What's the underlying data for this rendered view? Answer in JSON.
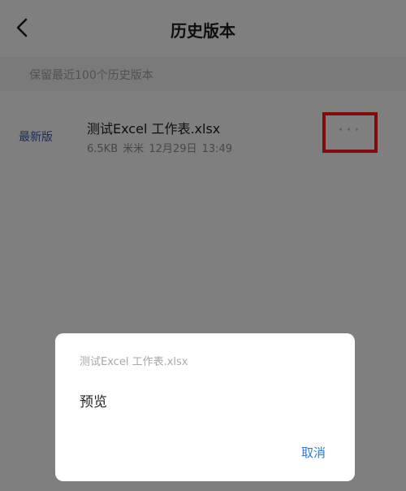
{
  "header": {
    "title": "历史版本"
  },
  "info": {
    "hint": "保留最近100个历史版本"
  },
  "version_item": {
    "badge": "最新版",
    "filename": "测试Excel 工作表.xlsx",
    "meta": "6.5KB  米米  12月29日 13:49",
    "more_glyph": "···"
  },
  "dialog": {
    "title": "测试Excel 工作表.xlsx",
    "preview_label": "预览",
    "cancel_label": "取消"
  },
  "colors": {
    "accent": "#2d7ad2",
    "latest_badge": "#3b5ea6",
    "highlight_box": "#ff1a1a"
  },
  "icons": {
    "back": "chevron-left-icon",
    "more": "more-horizontal-icon"
  }
}
